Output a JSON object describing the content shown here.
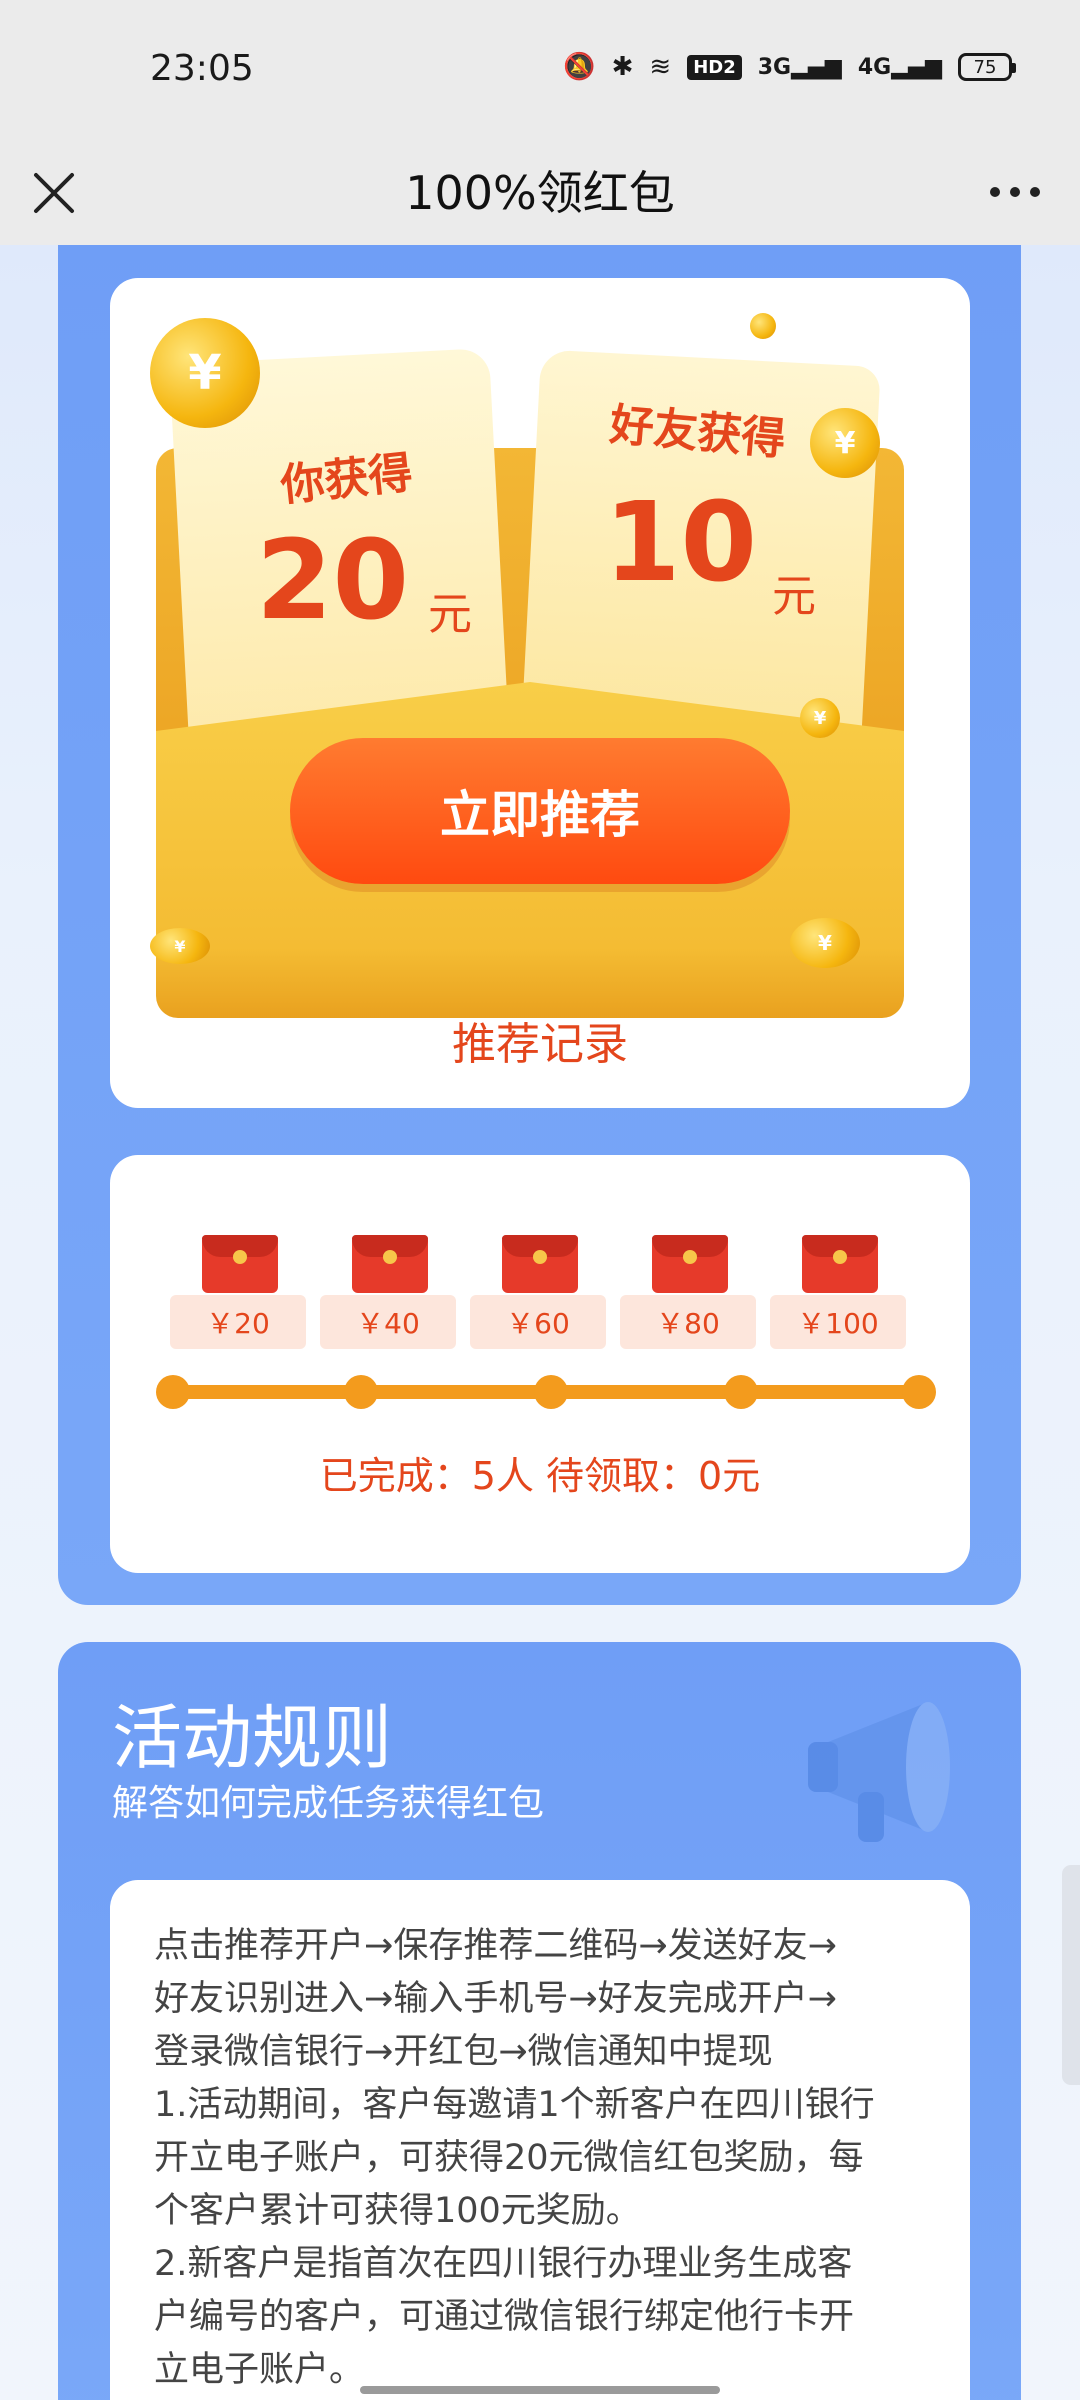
{
  "status": {
    "time": "23:05",
    "hd": "HD2",
    "sig1": "3G",
    "sig2": "4G",
    "battery": "75"
  },
  "nav": {
    "title": "100%领红包"
  },
  "reward": {
    "you_label": "你获得",
    "you_value": "20",
    "you_unit": "元",
    "friend_label": "好友获得",
    "friend_value": "10",
    "friend_unit": "元",
    "button": "立即推荐",
    "record_link": "推荐记录"
  },
  "progress": {
    "tiers": [
      "￥20",
      "￥40",
      "￥60",
      "￥80",
      "￥100"
    ],
    "summary": "已完成：5人 待领取：0元",
    "fraction": 1.0
  },
  "rules": {
    "title": "活动规则",
    "subtitle": "解答如何完成任务获得红包",
    "lines": [
      "点击推荐开户→保存推荐二维码→发送好友→",
      "好友识别进入→输入手机号→好友完成开户→",
      "登录微信银行→开红包→微信通知中提现",
      "1.活动期间，客户每邀请1个新客户在四川银行",
      "开立电子账户，可获得20元微信红包奖励，每",
      "个客户累计可获得100元奖励。",
      "2.新客户是指首次在四川银行办理业务生成客",
      "户编号的客户，可通过微信银行绑定他行卡开",
      "立电子账户。"
    ]
  },
  "colors": {
    "accent": "#e4461c",
    "panel_blue": "#6f9ef6",
    "orange": "#f39b1d"
  }
}
